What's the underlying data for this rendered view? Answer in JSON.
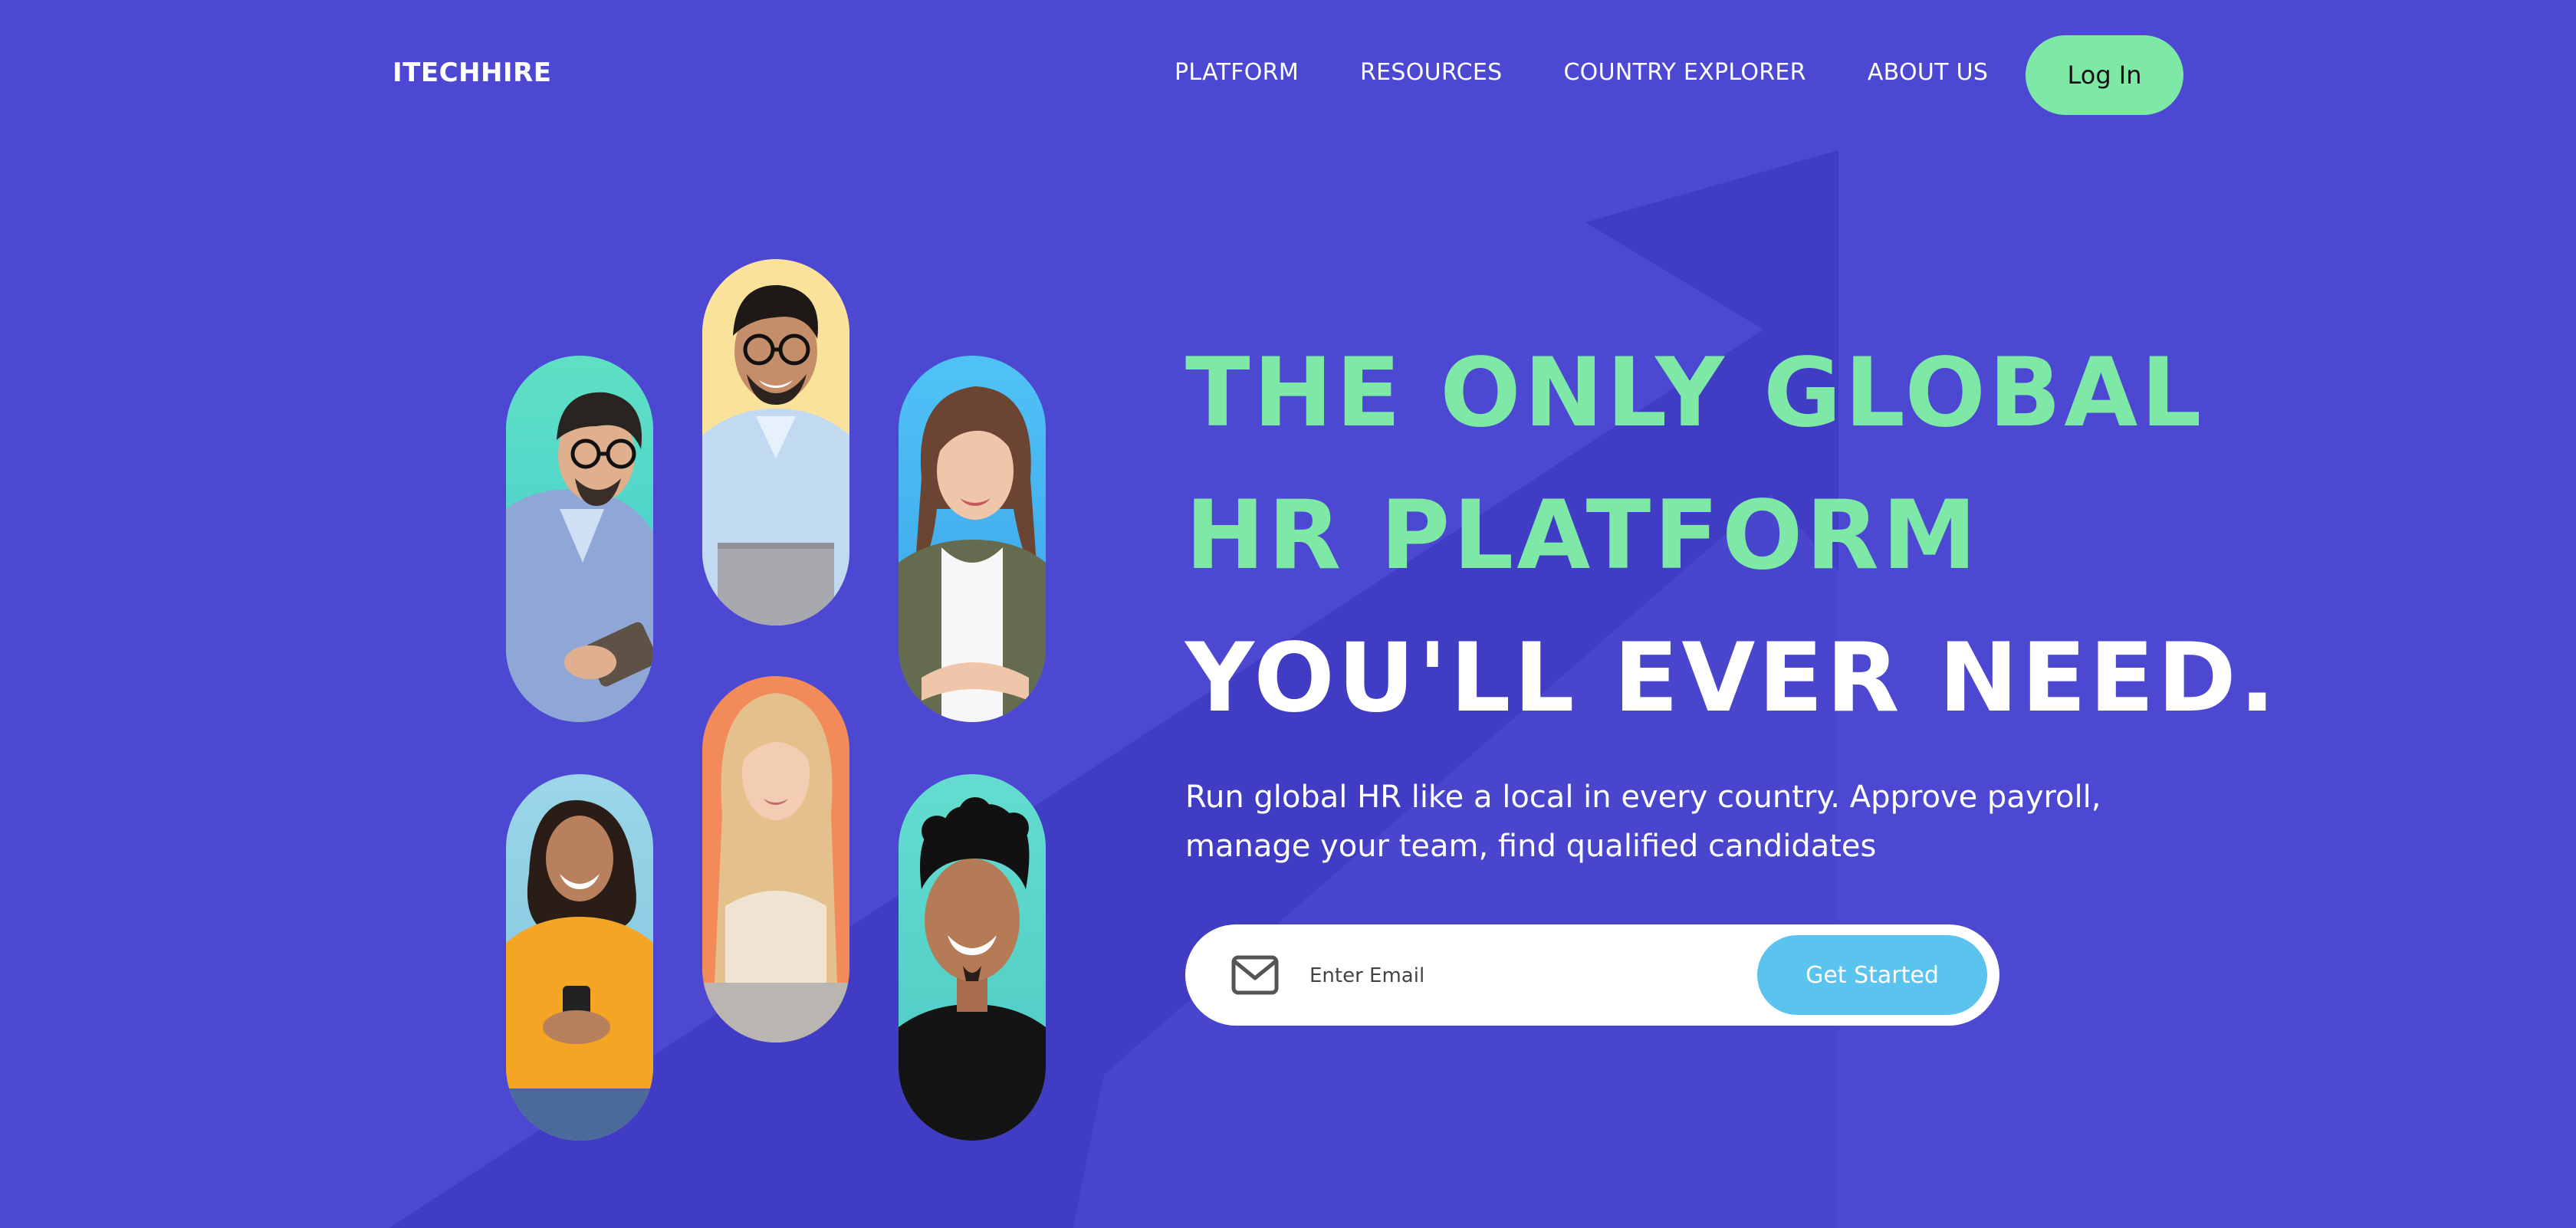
{
  "brand": {
    "name": "ITECHHIRE"
  },
  "nav": {
    "items": [
      {
        "label": "PLATFORM"
      },
      {
        "label": "RESOURCES"
      },
      {
        "label": "COUNTRY EXPLORER"
      },
      {
        "label": "ABOUT US"
      }
    ],
    "login_label": "Log In"
  },
  "hero": {
    "headline_line1": "THE ONLY GLOBAL",
    "headline_line2": "HR PLATFORM",
    "headline_line3": "YOU'LL EVER NEED.",
    "subtitle_line1": "Run global HR like a local in every country. Approve payroll,",
    "subtitle_line2": "manage your team, find qualified candidates"
  },
  "signup": {
    "email_placeholder": "Enter Email",
    "email_value": "",
    "button_label": "Get Started"
  },
  "icons": {
    "mail": "mail-icon"
  },
  "colors": {
    "background": "#4d48d1",
    "arrow": "#3f3bc2",
    "accent_green": "#7ee8a6",
    "button_blue": "#5bc4ee",
    "text_white": "#ffffff"
  }
}
